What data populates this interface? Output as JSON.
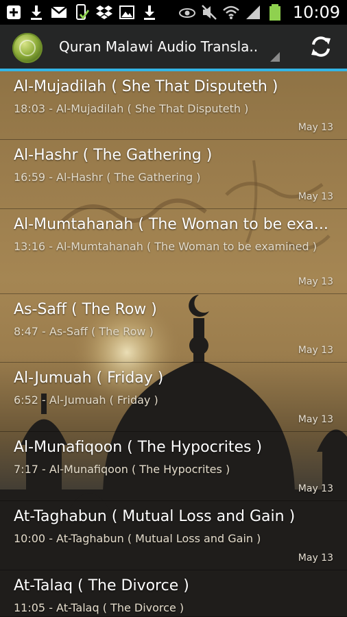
{
  "status_bar": {
    "left_icons": [
      "add-box-icon",
      "download-icon",
      "gmail-icon",
      "phone-check-icon",
      "dropbox-icon",
      "image-icon",
      "download-icon"
    ],
    "right_icons": [
      "eye-icon",
      "mute-icon",
      "wifi-icon",
      "signal-icon",
      "battery-icon"
    ],
    "time": "10:09"
  },
  "action_bar": {
    "title": "Quran Malawi Audio Transla..",
    "refresh_icon": "refresh-icon",
    "accent_color": "#33b5e5"
  },
  "items": [
    {
      "title": "Al-Mujadilah ( She That Disputeth )",
      "subtitle": "18:03 - Al-Mujadilah ( She That Disputeth )",
      "date": "May 13"
    },
    {
      "title": "Al-Hashr ( The Gathering )",
      "subtitle": "16:59 - Al-Hashr ( The Gathering )",
      "date": "May 13"
    },
    {
      "title": "Al-Mumtahanah ( The Woman to be exa...",
      "subtitle": "13:16 - Al-Mumtahanah ( The Woman to be examined )",
      "date": "May 13"
    },
    {
      "title": "As-Saff ( The Row )",
      "subtitle": "8:47 - As-Saff ( The Row )",
      "date": "May 13"
    },
    {
      "title": "Al-Jumuah ( Friday )",
      "subtitle": "6:52 - Al-Jumuah ( Friday )",
      "date": "May 13"
    },
    {
      "title": "Al-Munafiqoon ( The Hypocrites )",
      "subtitle": "7:17 - Al-Munafiqoon ( The Hypocrites )",
      "date": "May 13"
    },
    {
      "title": "At-Taghabun ( Mutual Loss and Gain )",
      "subtitle": "10:00 - At-Taghabun ( Mutual Loss and Gain )",
      "date": "May 13"
    },
    {
      "title": "At-Talaq ( The Divorce )",
      "subtitle": "11:05 - At-Talaq ( The Divorce )",
      "date": ""
    }
  ]
}
